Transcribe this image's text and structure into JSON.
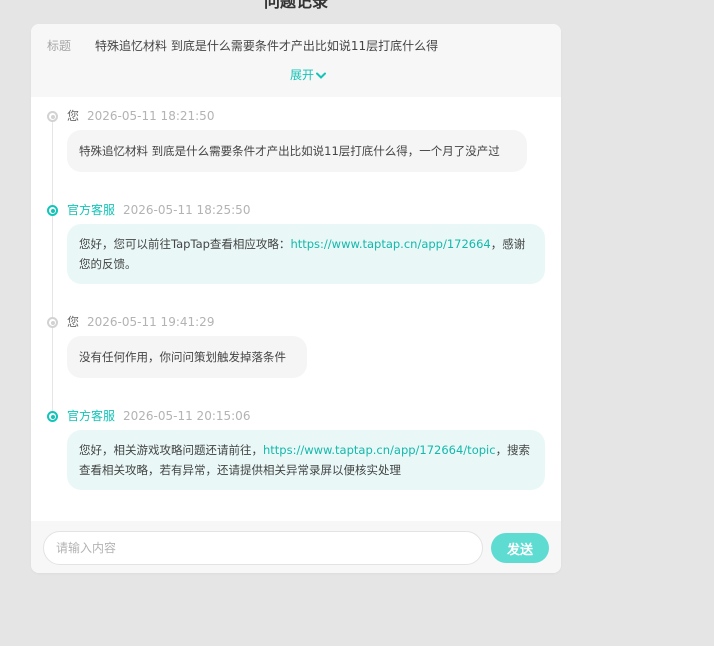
{
  "page": {
    "title": "问题记录"
  },
  "question": {
    "label": "标题",
    "text": "特殊追忆材料 到底是什么需要条件才产出比如说11层打底什么得",
    "expand_label": "展开"
  },
  "messages": [
    {
      "sender": "您",
      "time": "2026-05-11 18:21:50",
      "type": "user",
      "text": "特殊追忆材料 到底是什么需要条件才产出比如说11层打底什么得，一个月了没产过"
    },
    {
      "sender": "官方客服",
      "time": "2026-05-11 18:25:50",
      "type": "official",
      "text_before": "您好，您可以前往TapTap查看相应攻略：",
      "link": "https://www.taptap.cn/app/172664",
      "text_after": "，感谢您的反馈。"
    },
    {
      "sender": "您",
      "time": "2026-05-11 19:41:29",
      "type": "user",
      "text": "没有任何作用，你问问策划触发掉落条件"
    },
    {
      "sender": "官方客服",
      "time": "2026-05-11 20:15:06",
      "type": "official",
      "text_before": "您好，相关游戏攻略问题还请前往，",
      "link": "https://www.taptap.cn/app/172664/topic",
      "text_after": "，搜索查看相关攻略，若有异常，还请提供相关异常录屏以便核实处理"
    }
  ],
  "composer": {
    "placeholder": "请输入内容",
    "send_label": "发送"
  },
  "colors": {
    "accent": "#14c4b8",
    "send_button": "#5fdcd2",
    "official_bubble": "#e9f8f7",
    "user_bubble": "#f5f5f5"
  }
}
